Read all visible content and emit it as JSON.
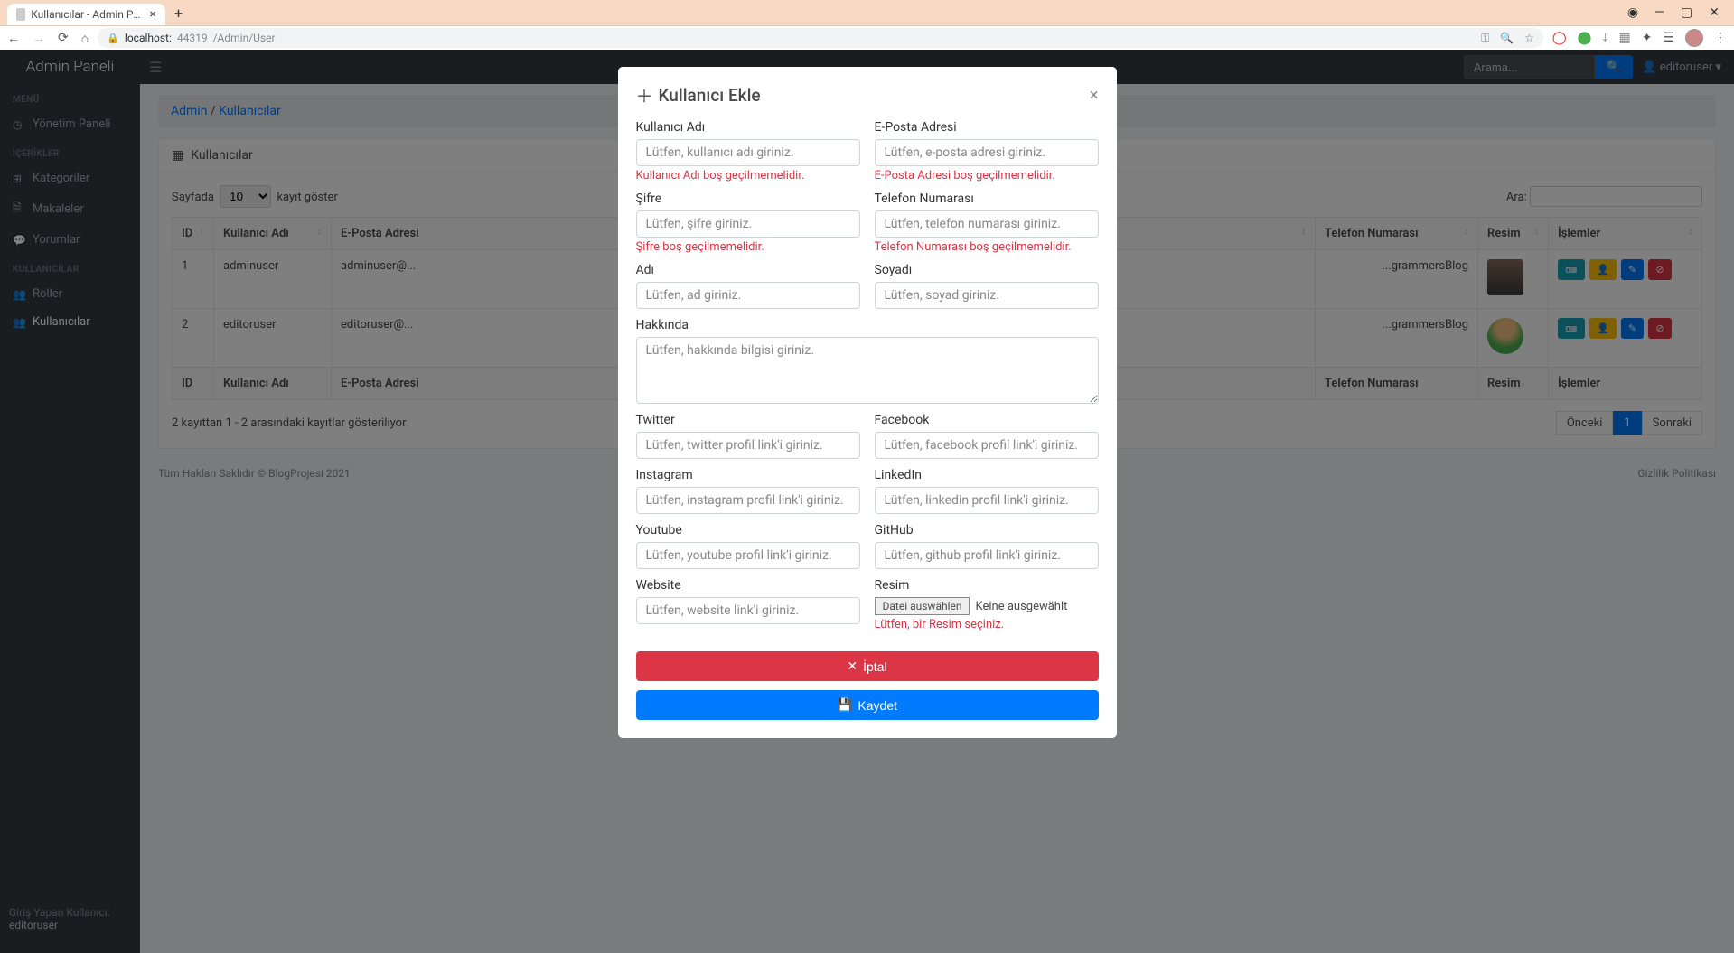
{
  "browser": {
    "tab_title": "Kullanıcılar - Admin Paneli | Blog",
    "url_host": "localhost:",
    "url_port": "44319",
    "url_path": "/Admin/User"
  },
  "topbar": {
    "brand": "Admin Paneli",
    "search_placeholder": "Arama...",
    "username": "editoruser"
  },
  "sidebar": {
    "sections": [
      {
        "label": "MENÜ",
        "items": [
          {
            "icon": "tachometer",
            "label": "Yönetim Paneli"
          }
        ]
      },
      {
        "label": "İÇERİKLER",
        "items": [
          {
            "icon": "tags",
            "label": "Kategoriler"
          },
          {
            "icon": "file",
            "label": "Makaleler"
          },
          {
            "icon": "comments",
            "label": "Yorumlar"
          }
        ]
      },
      {
        "label": "KULLANICILAR",
        "items": [
          {
            "icon": "id-badge",
            "label": "Roller"
          },
          {
            "icon": "users",
            "label": "Kullanıcılar",
            "active": true
          }
        ]
      }
    ],
    "footer_label": "Giriş Yapan Kullanıcı:",
    "footer_user": "editoruser"
  },
  "breadcrumb": {
    "first": "Admin",
    "sep": " / ",
    "second": "Kullanıcılar"
  },
  "card": {
    "title": "Kullanıcılar"
  },
  "datatable": {
    "length_pre": "Sayfada",
    "length_val": "10",
    "length_post": "kayıt göster",
    "search_label": "Ara:",
    "columns": [
      "ID",
      "Kullanıcı Adı",
      "E-Posta Adresi",
      "Telefon Numarası",
      "Resim",
      "İşlemler"
    ],
    "rows": [
      {
        "id": "1",
        "username": "adminuser",
        "email": "adminuser@...",
        "phone": "...grammersBlog",
        "avatar_class": "u1"
      },
      {
        "id": "2",
        "username": "editoruser",
        "email": "editoruser@...",
        "phone": "...grammersBlog",
        "avatar_class": "u2"
      }
    ],
    "info": "2 kayıttan 1 - 2 arasındaki kayıtlar gösteriliyor",
    "prev": "Önceki",
    "page": "1",
    "next": "Sonraki"
  },
  "footer": {
    "left": "Tüm Hakları Saklıdır © BlogProjesi 2021",
    "right": "Gizlilik Politikası"
  },
  "modal": {
    "title": "Kullanıcı Ekle",
    "fields": {
      "username": {
        "label": "Kullanıcı Adı",
        "placeholder": "Lütfen, kullanıcı adı giriniz.",
        "error": "Kullanıcı Adı boş geçilmemelidir."
      },
      "email": {
        "label": "E-Posta Adresi",
        "placeholder": "Lütfen, e-posta adresi giriniz.",
        "error": "E-Posta Adresi boş geçilmemelidir."
      },
      "password": {
        "label": "Şifre",
        "placeholder": "Lütfen, şifre giriniz.",
        "error": "Şifre boş geçilmemelidir."
      },
      "phone": {
        "label": "Telefon Numarası",
        "placeholder": "Lütfen, telefon numarası giriniz.",
        "error": "Telefon Numarası boş geçilmemelidir."
      },
      "firstname": {
        "label": "Adı",
        "placeholder": "Lütfen, ad giriniz."
      },
      "lastname": {
        "label": "Soyadı",
        "placeholder": "Lütfen, soyad giriniz."
      },
      "about": {
        "label": "Hakkında",
        "placeholder": "Lütfen, hakkında bilgisi giriniz."
      },
      "twitter": {
        "label": "Twitter",
        "placeholder": "Lütfen, twitter profil link'i giriniz."
      },
      "facebook": {
        "label": "Facebook",
        "placeholder": "Lütfen, facebook profil link'i giriniz."
      },
      "instagram": {
        "label": "Instagram",
        "placeholder": "Lütfen, instagram profil link'i giriniz."
      },
      "linkedin": {
        "label": "LinkedIn",
        "placeholder": "Lütfen, linkedin profil link'i giriniz."
      },
      "youtube": {
        "label": "Youtube",
        "placeholder": "Lütfen, youtube profil link'i giriniz."
      },
      "github": {
        "label": "GitHub",
        "placeholder": "Lütfen, github profil link'i giriniz."
      },
      "website": {
        "label": "Website",
        "placeholder": "Lütfen, website link'i giriniz."
      },
      "image": {
        "label": "Resim",
        "button": "Datei auswählen",
        "empty": "Keine ausgewählt",
        "error": "Lütfen, bir Resim seçiniz."
      }
    },
    "cancel": "İptal",
    "save": "Kaydet"
  }
}
